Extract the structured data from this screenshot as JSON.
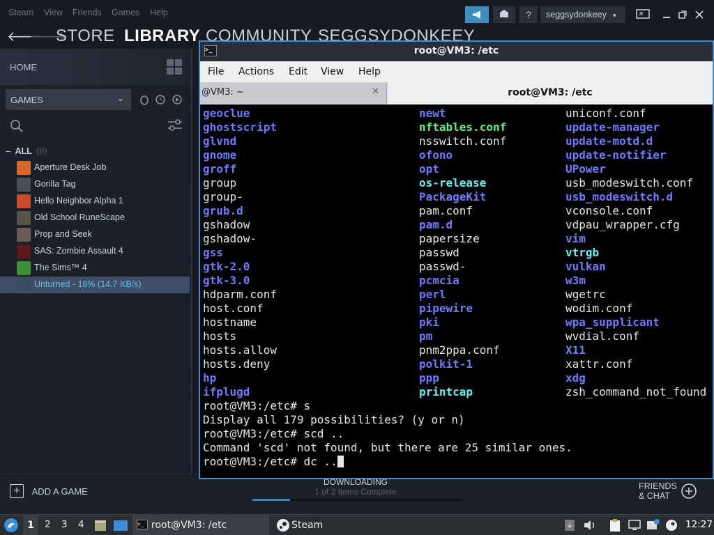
{
  "steam": {
    "menu": [
      "Steam",
      "View",
      "Friends",
      "Games",
      "Help"
    ],
    "nav": {
      "store": "STORE",
      "library": "LIBRARY",
      "community": "COMMUNITY",
      "profile": "SEGGSYDONKEEY"
    },
    "username": "seggsydonkeey",
    "help_glyph": "?",
    "home": "HOME",
    "games_filter": "GAMES",
    "all_label": "ALL",
    "all_count": "(8)",
    "games": [
      {
        "name": "Aperture Desk Job",
        "color": "#d8692b"
      },
      {
        "name": "Gorilla Tag",
        "color": "#4a4f55"
      },
      {
        "name": "Hello Neighbor Alpha 1",
        "color": "#c94a2a"
      },
      {
        "name": "Old School RuneScape",
        "color": "#57534a"
      },
      {
        "name": "Prop and Seek",
        "color": "#6b5b55"
      },
      {
        "name": "SAS: Zombie Assault 4",
        "color": "#5a1a1a"
      },
      {
        "name": "The Sims™ 4",
        "color": "#3d8f3a"
      },
      {
        "name": "Unturned - 18% (14.7 KB/s)",
        "color": "#3a4d5e",
        "selected": true
      }
    ],
    "add_game": "ADD A GAME",
    "downloading": "DOWNLOADING",
    "download_status": "1 of 2 Items Complete",
    "download_progress": 0.18,
    "friends_line1": "FRIENDS",
    "friends_line2": "& CHAT"
  },
  "terminal": {
    "title": "root@VM3: /etc",
    "menu": [
      "File",
      "Actions",
      "Edit",
      "View",
      "Help"
    ],
    "tab1": "@VM3: ~",
    "tab1_close": "✕",
    "tab2": "root@VM3: /etc",
    "col1": [
      {
        "t": "geoclue",
        "c": "dir"
      },
      {
        "t": "ghostscript",
        "c": "dir"
      },
      {
        "t": "glvnd",
        "c": "dir"
      },
      {
        "t": "gnome",
        "c": "dir"
      },
      {
        "t": "groff",
        "c": "dir"
      },
      {
        "t": "group",
        "c": "plain"
      },
      {
        "t": "group-",
        "c": "plain"
      },
      {
        "t": "grub.d",
        "c": "dir"
      },
      {
        "t": "gshadow",
        "c": "plain"
      },
      {
        "t": "gshadow-",
        "c": "plain"
      },
      {
        "t": "gss",
        "c": "dir"
      },
      {
        "t": "gtk-2.0",
        "c": "dir"
      },
      {
        "t": "gtk-3.0",
        "c": "dir"
      },
      {
        "t": "hdparm.conf",
        "c": "plain"
      },
      {
        "t": "host.conf",
        "c": "plain"
      },
      {
        "t": "hostname",
        "c": "plain"
      },
      {
        "t": "hosts",
        "c": "plain"
      },
      {
        "t": "hosts.allow",
        "c": "plain"
      },
      {
        "t": "hosts.deny",
        "c": "plain"
      },
      {
        "t": "hp",
        "c": "dir"
      },
      {
        "t": "ifplugd",
        "c": "dir"
      }
    ],
    "col2": [
      {
        "t": "newt",
        "c": "dir"
      },
      {
        "t": "nftables.conf",
        "c": "exec"
      },
      {
        "t": "nsswitch.conf",
        "c": "plain"
      },
      {
        "t": "ofono",
        "c": "dir"
      },
      {
        "t": "opt",
        "c": "dir"
      },
      {
        "t": "os-release",
        "c": "link"
      },
      {
        "t": "PackageKit",
        "c": "dir"
      },
      {
        "t": "pam.conf",
        "c": "plain"
      },
      {
        "t": "pam.d",
        "c": "dir"
      },
      {
        "t": "papersize",
        "c": "plain"
      },
      {
        "t": "passwd",
        "c": "plain"
      },
      {
        "t": "passwd-",
        "c": "plain"
      },
      {
        "t": "pcmcia",
        "c": "dir"
      },
      {
        "t": "perl",
        "c": "dir"
      },
      {
        "t": "pipewire",
        "c": "dir"
      },
      {
        "t": "pki",
        "c": "dir"
      },
      {
        "t": "pm",
        "c": "dir"
      },
      {
        "t": "pnm2ppa.conf",
        "c": "plain"
      },
      {
        "t": "polkit-1",
        "c": "dir"
      },
      {
        "t": "ppp",
        "c": "dir"
      },
      {
        "t": "printcap",
        "c": "link"
      }
    ],
    "col3": [
      {
        "t": "uniconf.conf",
        "c": "plain"
      },
      {
        "t": "update-manager",
        "c": "dir"
      },
      {
        "t": "update-motd.d",
        "c": "dir"
      },
      {
        "t": "update-notifier",
        "c": "dir"
      },
      {
        "t": "UPower",
        "c": "dir"
      },
      {
        "t": "usb_modeswitch.conf",
        "c": "plain"
      },
      {
        "t": "usb_modeswitch.d",
        "c": "dir"
      },
      {
        "t": "vconsole.conf",
        "c": "plain"
      },
      {
        "t": "vdpau_wrapper.cfg",
        "c": "plain"
      },
      {
        "t": "vim",
        "c": "dir"
      },
      {
        "t": "vtrgb",
        "c": "link"
      },
      {
        "t": "vulkan",
        "c": "dir"
      },
      {
        "t": "w3m",
        "c": "dir"
      },
      {
        "t": "wgetrc",
        "c": "plain"
      },
      {
        "t": "wodim.conf",
        "c": "plain"
      },
      {
        "t": "wpa_supplicant",
        "c": "dir"
      },
      {
        "t": "wvdial.conf",
        "c": "plain"
      },
      {
        "t": "X11",
        "c": "dir"
      },
      {
        "t": "xattr.conf",
        "c": "plain"
      },
      {
        "t": "xdg",
        "c": "dir"
      },
      {
        "t": "zsh_command_not_found",
        "c": "plain"
      }
    ],
    "output": [
      "root@VM3:/etc# s",
      "Display all 179 possibilities? (y or n)",
      "root@VM3:/etc# scd ..",
      "Command 'scd' not found, but there are 25 similar ones.",
      "root@VM3:/etc# dc .."
    ]
  },
  "taskbar": {
    "workspaces": [
      "1",
      "2",
      "3",
      "4"
    ],
    "terminal_task": "root@VM3: /etc",
    "steam_task": "Steam",
    "clock": "12:27"
  }
}
